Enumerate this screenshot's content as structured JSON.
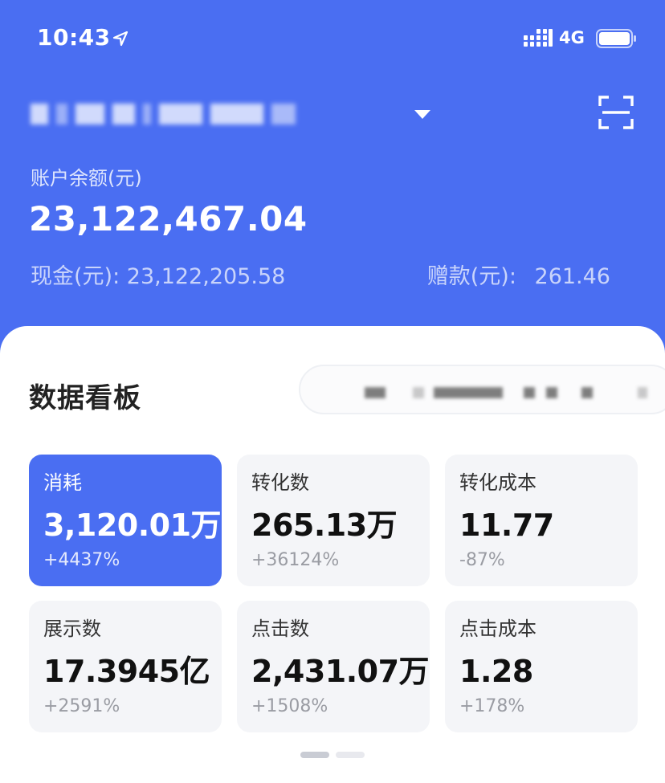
{
  "status_bar": {
    "time": "10:43",
    "network": "4G"
  },
  "account": {
    "balance_label": "账户余额(元)",
    "balance_value": "23,122,467.04",
    "cash_label": "现金(元):",
    "cash_value": "23,122,205.58",
    "bonus_label": "赠款(元):",
    "bonus_value": "261.46"
  },
  "dashboard": {
    "title": "数据看板",
    "metrics": [
      {
        "label": "消耗",
        "value": "3,120.01万",
        "change": "+4437%",
        "selected": true
      },
      {
        "label": "转化数",
        "value": "265.13万",
        "change": "+36124%",
        "selected": false
      },
      {
        "label": "转化成本",
        "value": "11.77",
        "change": "-87%",
        "selected": false
      },
      {
        "label": "展示数",
        "value": "17.3945亿",
        "change": "+2591%",
        "selected": false
      },
      {
        "label": "点击数",
        "value": "2,431.07万",
        "change": "+1508%",
        "selected": false
      },
      {
        "label": "点击成本",
        "value": "1.28",
        "change": "+178%",
        "selected": false
      }
    ]
  },
  "colors": {
    "brand": "#4a6ef2",
    "card_bg": "#f4f5f8"
  },
  "icons": [
    "location-arrow-icon",
    "signal-icon",
    "battery-icon",
    "chevron-down-icon",
    "scan-icon"
  ]
}
